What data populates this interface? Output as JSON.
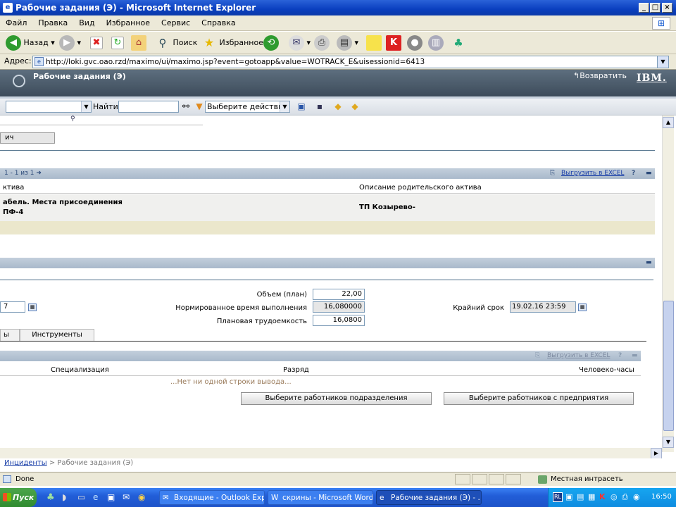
{
  "window": {
    "title": "Рабочие задания (Э) - Microsoft Internet Explorer",
    "icon": "ie-icon"
  },
  "menu": [
    "Файл",
    "Правка",
    "Вид",
    "Избранное",
    "Сервис",
    "Справка"
  ],
  "toolbar": {
    "back": "Назад",
    "search": "Поиск",
    "favorites": "Избранное"
  },
  "address": {
    "label": "Адрес:",
    "url": "http://loki.gvc.oao.rzd/maximo/ui/maximo.jsp?event=gotoapp&value=WOTRACK_E&uisessionid=6413"
  },
  "app": {
    "title": "Рабочие задания (Э)",
    "return_label": "Возвратить",
    "brand": "IBM."
  },
  "app_toolbar": {
    "find_label": "Найти:",
    "action_select": "Выберите действие"
  },
  "partial_field": "ич",
  "assets_section": {
    "pager": "1 - 1 из 1",
    "export_label": "Выгрузить в EXCEL",
    "col_asset": "ктива",
    "col_parent": "Описание родительского актива",
    "row_asset_line1": "абель. Места присоединения",
    "row_asset_line2": "ПФ-4",
    "row_parent": "ТП Козырево-"
  },
  "plan": {
    "volume_label": "Объем (план)",
    "volume_value": "22,00",
    "norm_time_label": "Нормированное время выполнения",
    "norm_time_value": "16,080000",
    "labor_label": "Плановая трудоемкость",
    "labor_value": "16,0800",
    "deadline_label": "Крайний срок",
    "deadline_value": "19.02.16 23:59",
    "left_partial_value": "7"
  },
  "tabs": {
    "partial": "ы",
    "tools": "Инструменты"
  },
  "labor_table": {
    "export_label": "Выгрузить в EXCEL",
    "col_spec": "Специализация",
    "col_grade": "Разряд",
    "col_hours": "Человеко-часы",
    "empty_msg": "...Нет ни одной строки вывода...",
    "btn_dept": "Выберите работников подразделения",
    "btn_company": "Выберите работников с предприятия"
  },
  "breadcrumb": {
    "link": "Инциденты",
    "sep": " > ",
    "current": "Рабочие задания (Э)"
  },
  "status": {
    "left": "Done",
    "zone": "Местная интрасеть"
  },
  "taskbar": {
    "start": "Пуск",
    "tasks": [
      "Входящие - Outlook Exp...",
      "скрины - Microsoft Word",
      "Рабочие задания (Э) - ..."
    ],
    "lang": "RL",
    "clock": "16:50"
  },
  "colors": {
    "title_bar": "#0a3fbf",
    "app_header": "#4a5a6a",
    "section_bar": "#b4c3d4",
    "link": "#1a3fa8"
  }
}
